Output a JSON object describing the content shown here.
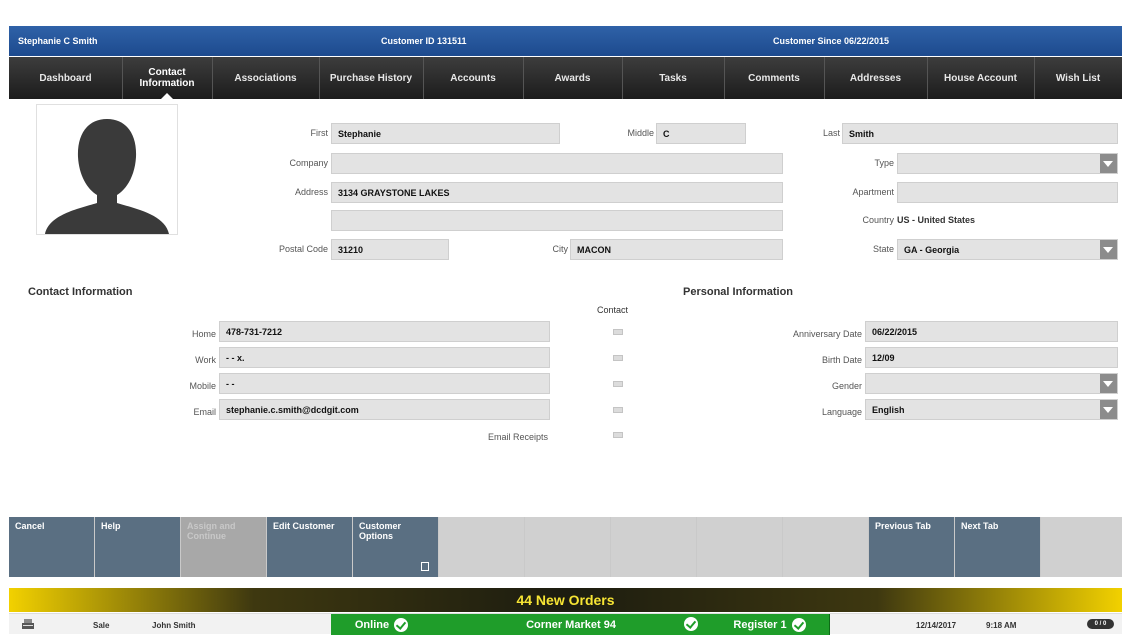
{
  "header": {
    "customer_name": "Stephanie C Smith",
    "customer_id": "Customer ID 131511",
    "customer_since": "Customer Since 06/22/2015"
  },
  "nav": {
    "tabs": [
      {
        "label": "Dashboard"
      },
      {
        "label": "Contact Information",
        "active": true
      },
      {
        "label": "Associations"
      },
      {
        "label": "Purchase History"
      },
      {
        "label": "Accounts"
      },
      {
        "label": "Awards"
      },
      {
        "label": "Tasks"
      },
      {
        "label": "Comments"
      },
      {
        "label": "Addresses"
      },
      {
        "label": "House Account"
      },
      {
        "label": "Wish List"
      }
    ]
  },
  "address_form": {
    "first_label": "First",
    "first_value": "Stephanie",
    "middle_label": "Middle",
    "middle_value": "C",
    "last_label": "Last",
    "last_value": "Smith",
    "company_label": "Company",
    "company_value": "",
    "type_label": "Type",
    "type_value": "",
    "address_label": "Address",
    "address_value": "3134 GRAYSTONE LAKES",
    "address2_value": "",
    "apartment_label": "Apartment",
    "apartment_value": "",
    "country_label": "Country",
    "country_value": "US - United States",
    "postal_label": "Postal Code",
    "postal_value": "31210",
    "city_label": "City",
    "city_value": "MACON",
    "state_label": "State",
    "state_value": "GA - Georgia"
  },
  "contact": {
    "section_title": "Contact Information",
    "contact_header": "Contact",
    "home_label": "Home",
    "home_value": "478-731-7212",
    "work_label": "Work",
    "work_value": "- -  x.",
    "mobile_label": "Mobile",
    "mobile_value": "- -",
    "email_label": "Email",
    "email_value": "stephanie.c.smith@dcdgit.com",
    "email_receipts_label": "Email Receipts"
  },
  "personal": {
    "section_title": "Personal Information",
    "anniversary_label": "Anniversary Date",
    "anniversary_value": "06/22/2015",
    "birth_label": "Birth Date",
    "birth_value": "12/09",
    "gender_label": "Gender",
    "gender_value": "",
    "language_label": "Language",
    "language_value": "English"
  },
  "actions": {
    "cancel": "Cancel",
    "help": "Help",
    "assign": "Assign and Continue",
    "edit": "Edit Customer",
    "options": "Customer Options",
    "previous": "Previous Tab",
    "next": "Next Tab"
  },
  "orders_banner": "44 New Orders",
  "status": {
    "mode": "Sale",
    "user": "John Smith",
    "online": "Online",
    "store": "Corner Market 94",
    "register": "Register 1",
    "date": "12/14/2017",
    "time": "9:18 AM",
    "pill": "0 / 0"
  }
}
